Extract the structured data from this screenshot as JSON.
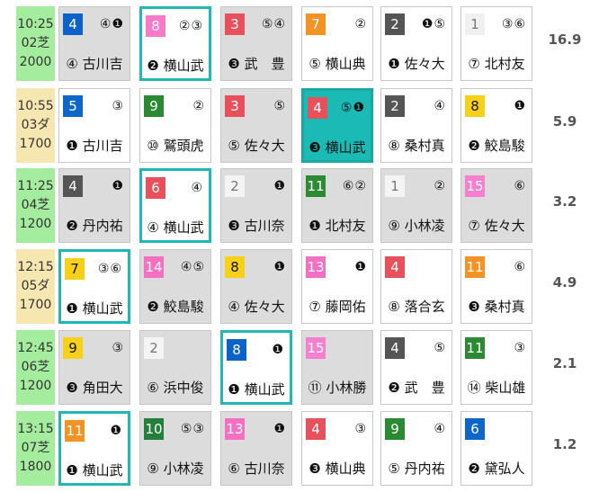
{
  "colors": {
    "frame": {
      "1": "#f4f4f4",
      "2": "#555555",
      "3": "#e8505b",
      "4": "#0f66c9",
      "5": "#f7bd35",
      "6": "#1a9dd9",
      "7": "#f39323",
      "8": "#f7d117",
      "9": "#2a8a31",
      "10": "#22803a",
      "11": "#2c8a32",
      "13": "#f574c2",
      "14": "#f56fc2",
      "15": "#f77fcf"
    },
    "accent_teal": "#20b8b5"
  },
  "races": [
    {
      "time": "10:25",
      "race": "02芝",
      "dist": "2000",
      "surface": "turf",
      "odds": "16.9",
      "cells": [
        {
          "num": "4",
          "numColor": "#0c62c9",
          "marks": "④❶",
          "jockey": "④ 古川吉",
          "style": "gray"
        },
        {
          "num": "8",
          "numColor": "#f87ac9",
          "marks": "②③",
          "jockey": "❷ 横山武",
          "style": "hl"
        },
        {
          "num": "3",
          "numColor": "#e8505b",
          "marks": "⑤④",
          "jockey": "❸ 武　豊",
          "style": "gray"
        },
        {
          "num": "7",
          "numColor": "#f39323",
          "marks": "②",
          "jockey": "⑤ 横山典",
          "style": "white"
        },
        {
          "num": "2",
          "numColor": "#555555",
          "marks": "❶⑤",
          "jockey": "❶ 佐々大",
          "style": "white"
        },
        {
          "num": "1",
          "numColor": "#f0f0f0",
          "numText": "#777777",
          "marks": "③⑥",
          "jockey": "⑦ 北村友",
          "style": "white"
        }
      ]
    },
    {
      "time": "10:55",
      "race": "03ダ",
      "dist": "1700",
      "surface": "dirt",
      "odds": "5.9",
      "cells": [
        {
          "num": "5",
          "numColor": "#0f66c9",
          "marks": "③",
          "jockey": "❶ 古川吉",
          "style": "white"
        },
        {
          "num": "9",
          "numColor": "#2a8a31",
          "marks": "②",
          "jockey": "⑩ 鷲頭虎",
          "style": "white"
        },
        {
          "num": "3",
          "numColor": "#e8505b",
          "marks": "⑤",
          "jockey": "⑤ 佐々大",
          "style": "gray"
        },
        {
          "num": "4",
          "numColor": "#e8505b",
          "marks": "⑤❶",
          "jockey": "❸ 横山武",
          "style": "tealfill"
        },
        {
          "num": "2",
          "numColor": "#555555",
          "marks": "④",
          "jockey": "⑧ 桑村真",
          "style": "white"
        },
        {
          "num": "8",
          "numColor": "#f7d117",
          "numText": "#111111",
          "marks": "❶",
          "jockey": "❷ 鮫島駿",
          "style": "white"
        }
      ]
    },
    {
      "time": "11:25",
      "race": "04芝",
      "dist": "1200",
      "surface": "turf",
      "odds": "3.2",
      "cells": [
        {
          "num": "4",
          "numColor": "#555555",
          "marks": "❶",
          "jockey": "❷ 丹内祐",
          "style": "gray"
        },
        {
          "num": "6",
          "numColor": "#e8505b",
          "marks": "④",
          "jockey": "④ 横山武",
          "style": "hl"
        },
        {
          "num": "2",
          "numColor": "#f4f4f4",
          "numText": "#777777",
          "marks": "❶",
          "jockey": "❸ 古川奈",
          "style": "gray"
        },
        {
          "num": "11",
          "numColor": "#2c8a32",
          "marks": "⑥②",
          "jockey": "❶ 北村友",
          "style": "gray"
        },
        {
          "num": "1",
          "numColor": "#f4f4f4",
          "numText": "#777777",
          "marks": "②",
          "jockey": "⑨ 小林凌",
          "style": "gray"
        },
        {
          "num": "15",
          "numColor": "#f77fcf",
          "marks": "⑥",
          "jockey": "⑦ 佐々大",
          "style": "gray"
        }
      ]
    },
    {
      "time": "12:15",
      "race": "05ダ",
      "dist": "1700",
      "surface": "dirt",
      "odds": "4.9",
      "cells": [
        {
          "num": "7",
          "numColor": "#f7d117",
          "numText": "#111111",
          "marks": "③⑥",
          "jockey": "❶ 横山武",
          "style": "hl"
        },
        {
          "num": "14",
          "numColor": "#f56fc2",
          "marks": "④⑤",
          "jockey": "❷ 鮫島駿",
          "style": "gray"
        },
        {
          "num": "8",
          "numColor": "#f7d117",
          "numText": "#111111",
          "marks": "❶",
          "jockey": "④ 佐々大",
          "style": "gray"
        },
        {
          "num": "13",
          "numColor": "#f56fc2",
          "marks": "❶",
          "jockey": "⑦ 藤岡佑",
          "style": "white"
        },
        {
          "num": "4",
          "numColor": "#e8505b",
          "marks": "",
          "jockey": "⑧ 落合玄",
          "style": "white"
        },
        {
          "num": "11",
          "numColor": "#f39323",
          "marks": "⑥",
          "jockey": "❸ 桑村真",
          "style": "white"
        }
      ]
    },
    {
      "time": "12:45",
      "race": "06芝",
      "dist": "1200",
      "surface": "turf",
      "odds": "2.1",
      "cells": [
        {
          "num": "9",
          "numColor": "#f7d117",
          "numText": "#111111",
          "marks": "③",
          "jockey": "❸ 角田大",
          "style": "gray"
        },
        {
          "num": "2",
          "numColor": "#f4f4f4",
          "numText": "#777777",
          "marks": "",
          "jockey": "⑥ 浜中俊",
          "style": "gray"
        },
        {
          "num": "8",
          "numColor": "#0c62c9",
          "marks": "❶",
          "jockey": "❶ 横山武",
          "style": "hl"
        },
        {
          "num": "15",
          "numColor": "#f77fcf",
          "marks": "",
          "jockey": "⑪ 小林勝",
          "style": "gray"
        },
        {
          "num": "4",
          "numColor": "#555555",
          "marks": "⑤",
          "jockey": "❷ 武　豊",
          "style": "white"
        },
        {
          "num": "11",
          "numColor": "#2c8a32",
          "marks": "③",
          "jockey": "⑭ 柴山雄",
          "style": "white"
        }
      ]
    },
    {
      "time": "13:15",
      "race": "07芝",
      "dist": "1800",
      "surface": "turf",
      "odds": "1.2",
      "cells": [
        {
          "num": "11",
          "numColor": "#f39323",
          "marks": "❶",
          "jockey": "❶ 横山武",
          "style": "hl"
        },
        {
          "num": "10",
          "numColor": "#22803a",
          "marks": "⑤③",
          "jockey": "⑨ 小林凌",
          "style": "gray"
        },
        {
          "num": "13",
          "numColor": "#f56fc2",
          "marks": "❶",
          "jockey": "⑥ 古川奈",
          "style": "gray"
        },
        {
          "num": "4",
          "numColor": "#e8505b",
          "marks": "③",
          "jockey": "❸ 横山典",
          "style": "white"
        },
        {
          "num": "9",
          "numColor": "#2a8a31",
          "marks": "④",
          "jockey": "⑤ 丹内祐",
          "style": "white"
        },
        {
          "num": "6",
          "numColor": "#0f66c9",
          "marks": "",
          "jockey": "❷ 黛弘人",
          "style": "white"
        }
      ]
    }
  ]
}
